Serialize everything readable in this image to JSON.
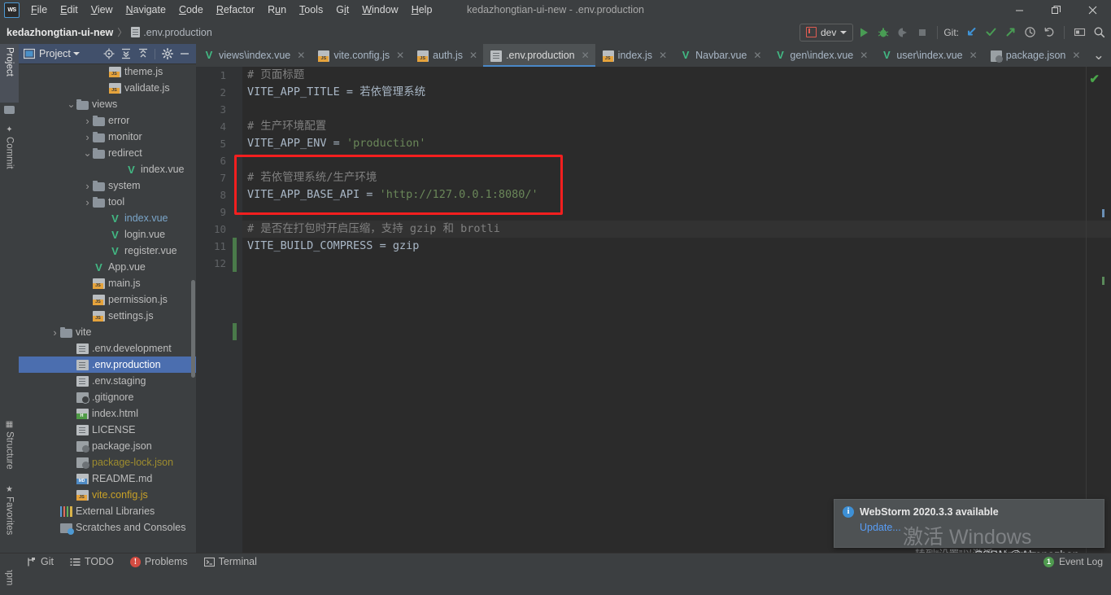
{
  "window": {
    "title": "kedazhongtian-ui-new - .env.production",
    "logo_text": "WS",
    "controls": {
      "minimize": "—",
      "maximize": "❐",
      "close": "✕"
    }
  },
  "menubar": [
    {
      "label": "File"
    },
    {
      "label": "Edit"
    },
    {
      "label": "View"
    },
    {
      "label": "Navigate"
    },
    {
      "label": "Code"
    },
    {
      "label": "Refactor"
    },
    {
      "label": "Run"
    },
    {
      "label": "Tools"
    },
    {
      "label": "Git"
    },
    {
      "label": "Window"
    },
    {
      "label": "Help"
    }
  ],
  "breadcrumb": {
    "project": "kedazhongtian-ui-new",
    "separator": "〉",
    "file": ".env.production"
  },
  "toolbar": {
    "run_config": "dev",
    "run_title": "Run",
    "debug_title": "Debug",
    "coverage_title": "Run with Coverage",
    "stop_title": "Stop",
    "git_label": "Git:",
    "git_update_title": "Update Project",
    "git_commit_title": "Commit",
    "git_push_title": "Push",
    "history_title": "History",
    "undo_title": "Undo",
    "layout_title": "Toggle Layout",
    "search_title": "Search Everywhere"
  },
  "toolstrip": {
    "left": [
      {
        "label": "Project",
        "active": true
      },
      {
        "label": "Commit",
        "active": false
      },
      {
        "label": "Structure",
        "active": false
      },
      {
        "label": "Favorites",
        "active": false
      },
      {
        "label": "npm",
        "active": false
      }
    ]
  },
  "project_panel": {
    "title": "Project",
    "icons": [
      "locate-icon",
      "expand-all-icon",
      "collapse-all-icon",
      "settings-gear-icon",
      "hide-icon"
    ],
    "tree": [
      {
        "indent": 3,
        "arrow": "",
        "icon": "js",
        "label": "theme.js",
        "color": "#bdbdbd"
      },
      {
        "indent": 3,
        "arrow": "",
        "icon": "js",
        "label": "validate.js",
        "color": "#bdbdbd"
      },
      {
        "indent": 1,
        "arrow": "v",
        "icon": "folder",
        "label": "views",
        "color": "#bdbdbd"
      },
      {
        "indent": 2,
        "arrow": ">",
        "icon": "folder",
        "label": "error",
        "color": "#bdbdbd"
      },
      {
        "indent": 2,
        "arrow": ">",
        "icon": "folder",
        "label": "monitor",
        "color": "#bdbdbd"
      },
      {
        "indent": 2,
        "arrow": "v",
        "icon": "folder",
        "label": "redirect",
        "color": "#bdbdbd"
      },
      {
        "indent": 4,
        "arrow": "",
        "icon": "vue",
        "label": "index.vue",
        "color": "#bdbdbd"
      },
      {
        "indent": 2,
        "arrow": ">",
        "icon": "folder",
        "label": "system",
        "color": "#bdbdbd"
      },
      {
        "indent": 2,
        "arrow": ">",
        "icon": "folder",
        "label": "tool",
        "color": "#bdbdbd"
      },
      {
        "indent": 3,
        "arrow": "",
        "icon": "vue",
        "label": "index.vue",
        "color": "#7aa5c9"
      },
      {
        "indent": 3,
        "arrow": "",
        "icon": "vue",
        "label": "login.vue",
        "color": "#bdbdbd"
      },
      {
        "indent": 3,
        "arrow": "",
        "icon": "vue",
        "label": "register.vue",
        "color": "#bdbdbd"
      },
      {
        "indent": 2,
        "arrow": "",
        "icon": "vue",
        "label": "App.vue",
        "color": "#bdbdbd"
      },
      {
        "indent": 2,
        "arrow": "",
        "icon": "js",
        "label": "main.js",
        "color": "#bdbdbd"
      },
      {
        "indent": 2,
        "arrow": "",
        "icon": "js",
        "label": "permission.js",
        "color": "#bdbdbd"
      },
      {
        "indent": 2,
        "arrow": "",
        "icon": "js",
        "label": "settings.js",
        "color": "#bdbdbd"
      },
      {
        "indent": 0,
        "arrow": ">",
        "icon": "folder",
        "label": "vite",
        "color": "#bdbdbd"
      },
      {
        "indent": 1,
        "arrow": "",
        "icon": "file",
        "label": ".env.development",
        "color": "#bdbdbd"
      },
      {
        "indent": 1,
        "arrow": "",
        "icon": "file",
        "label": ".env.production",
        "color": "#ffffff",
        "selected": true
      },
      {
        "indent": 1,
        "arrow": "",
        "icon": "file",
        "label": ".env.staging",
        "color": "#bdbdbd"
      },
      {
        "indent": 1,
        "arrow": "",
        "icon": "git",
        "label": ".gitignore",
        "color": "#bdbdbd"
      },
      {
        "indent": 1,
        "arrow": "",
        "icon": "html",
        "label": "index.html",
        "color": "#bdbdbd"
      },
      {
        "indent": 1,
        "arrow": "",
        "icon": "file",
        "label": "LICENSE",
        "color": "#bdbdbd"
      },
      {
        "indent": 1,
        "arrow": "",
        "icon": "json",
        "label": "package.json",
        "color": "#bdbdbd"
      },
      {
        "indent": 1,
        "arrow": "",
        "icon": "json",
        "label": "package-lock.json",
        "color": "#9e8c2e"
      },
      {
        "indent": 1,
        "arrow": "",
        "icon": "md",
        "label": "README.md",
        "color": "#bdbdbd"
      },
      {
        "indent": 1,
        "arrow": "",
        "icon": "js",
        "label": "vite.config.js",
        "color": "#c9a227"
      },
      {
        "indent": 0,
        "arrow": "",
        "icon": "lib",
        "label": "External Libraries",
        "color": "#bdbdbd"
      },
      {
        "indent": 0,
        "arrow": "",
        "icon": "scratch",
        "label": "Scratches and Consoles",
        "color": "#bdbdbd"
      }
    ]
  },
  "editor_tabs": {
    "tabs": [
      {
        "label": "views\\index.vue",
        "icon": "vue",
        "active": false
      },
      {
        "label": "vite.config.js",
        "icon": "js",
        "active": false
      },
      {
        "label": "auth.js",
        "icon": "js",
        "active": false
      },
      {
        "label": ".env.production",
        "icon": "file",
        "active": true
      },
      {
        "label": "index.js",
        "icon": "js",
        "active": false
      },
      {
        "label": "Navbar.vue",
        "icon": "vue",
        "active": false
      },
      {
        "label": "gen\\index.vue",
        "icon": "vue",
        "active": false
      },
      {
        "label": "user\\index.vue",
        "icon": "vue",
        "active": false
      },
      {
        "label": "package.json",
        "icon": "json",
        "active": false
      }
    ],
    "close_glyph": "✕",
    "more_glyph": "⌄"
  },
  "editor": {
    "filename": ".env.production",
    "line_numbers": [
      "1",
      "2",
      "3",
      "4",
      "5",
      "6",
      "7",
      "8",
      "9",
      "10",
      "11",
      "12"
    ],
    "lines": [
      {
        "n": 1,
        "tokens": [
          {
            "t": "# 页面标题",
            "c": "cm"
          }
        ]
      },
      {
        "n": 2,
        "tokens": [
          {
            "t": "VITE_APP_TITLE",
            "c": "cv"
          },
          {
            "t": " = ",
            "c": "cop"
          },
          {
            "t": "若依管理系统",
            "c": "cval"
          }
        ]
      },
      {
        "n": 3,
        "tokens": []
      },
      {
        "n": 4,
        "tokens": [
          {
            "t": "# 生产环境配置",
            "c": "cm"
          }
        ]
      },
      {
        "n": 5,
        "tokens": [
          {
            "t": "VITE_APP_ENV",
            "c": "cv"
          },
          {
            "t": " = ",
            "c": "cop"
          },
          {
            "t": "'production'",
            "c": "cs"
          }
        ]
      },
      {
        "n": 6,
        "tokens": []
      },
      {
        "n": 7,
        "tokens": [
          {
            "t": "# 若依管理系统/生产环境",
            "c": "cm"
          }
        ]
      },
      {
        "n": 8,
        "tokens": [
          {
            "t": "VITE_APP_BASE_API",
            "c": "cv"
          },
          {
            "t": " = ",
            "c": "cop"
          },
          {
            "t": "'http://127.0.0.1:8080/'",
            "c": "cs"
          }
        ]
      },
      {
        "n": 9,
        "tokens": []
      },
      {
        "n": 10,
        "tokens": [
          {
            "t": "# 是否在打包时开启压缩，支持 gzip 和 brotli",
            "c": "cm"
          }
        ]
      },
      {
        "n": 11,
        "tokens": [
          {
            "t": "VITE_BUILD_COMPRESS",
            "c": "cv"
          },
          {
            "t": " = ",
            "c": "cop"
          },
          {
            "t": "gzip",
            "c": "cval"
          }
        ]
      },
      {
        "n": 12,
        "tokens": []
      }
    ],
    "inspection_status": "✔",
    "highlight_box_color": "#f41f1f"
  },
  "notification": {
    "icon": "info-icon",
    "title": "WebStorm 2020.3.3 available",
    "link": "Update..."
  },
  "watermark": {
    "activate_title": "激活 Windows",
    "activate_sub": "转到“设置”以激活 Windows。",
    "credit": "CSDN @Abenazhan"
  },
  "statusbar": {
    "items": [
      {
        "label": "Git",
        "icon": "git-branch-icon"
      },
      {
        "label": "TODO",
        "icon": "todo-list-icon"
      },
      {
        "label": "Problems",
        "icon": "problems-error-icon"
      },
      {
        "label": "Terminal",
        "icon": "terminal-icon"
      }
    ],
    "event_log": {
      "label": "Event Log",
      "count": "1"
    }
  },
  "colors": {
    "accent_blue": "#4b6eaf",
    "editor_bg": "#2b2b2b",
    "panel_bg": "#3c3f41",
    "highlight_red": "#f41f1f",
    "vue_green": "#42b883",
    "string_green": "#6a8759",
    "comment_grey": "#808080"
  }
}
